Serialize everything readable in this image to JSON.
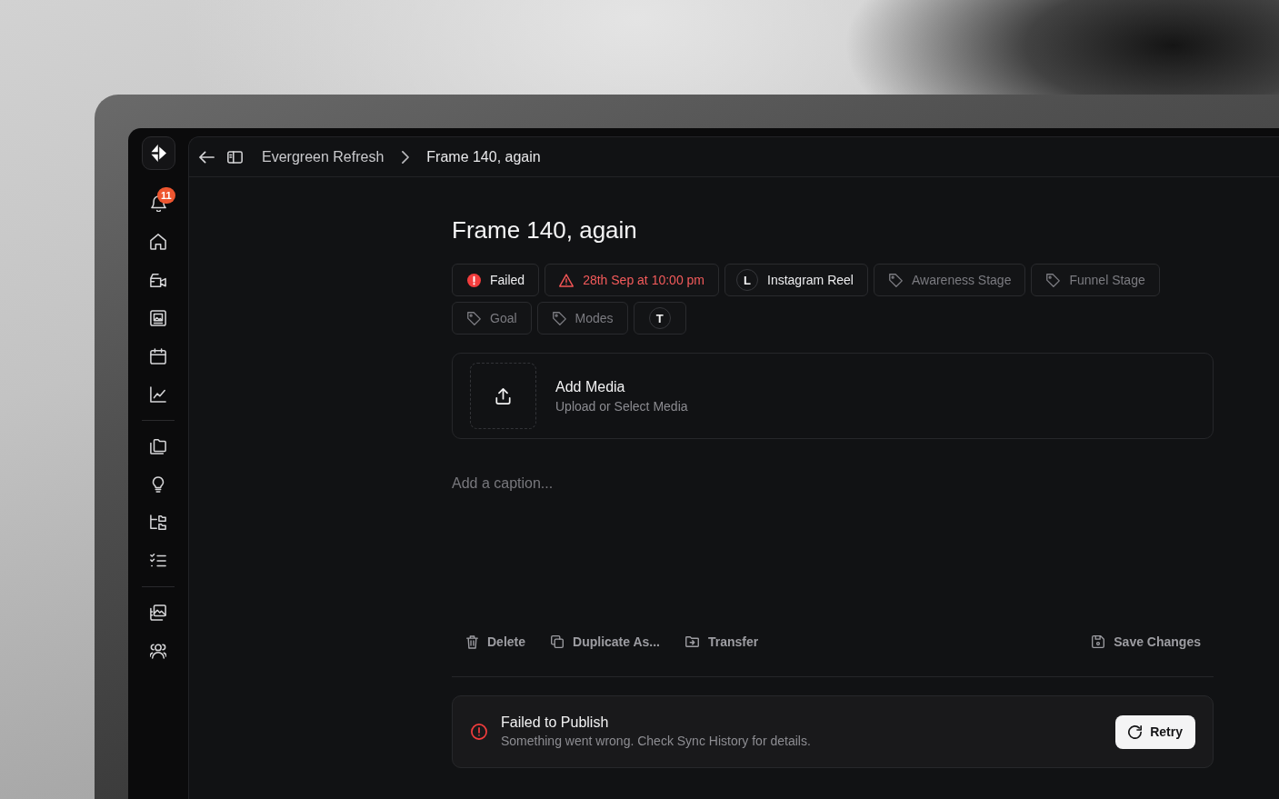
{
  "sidebar": {
    "notification_badge": "11"
  },
  "breadcrumb": [
    {
      "label": "Evergreen Refresh"
    },
    {
      "label": "Frame 140, again"
    }
  ],
  "title": "Frame 140, again",
  "chips": [
    {
      "kind": "status",
      "label": "Failed"
    },
    {
      "kind": "date",
      "label": "28th Sep at 10:00 pm"
    },
    {
      "kind": "account",
      "initial": "L",
      "label": "Instagram Reel"
    },
    {
      "kind": "tag",
      "label": "Awareness Stage"
    },
    {
      "kind": "tag",
      "label": "Funnel Stage"
    },
    {
      "kind": "tag",
      "label": "Goal"
    },
    {
      "kind": "tag",
      "label": "Modes"
    },
    {
      "kind": "assignee",
      "initial": "T"
    }
  ],
  "media": {
    "title": "Add Media",
    "subtitle": "Upload or Select Media"
  },
  "caption": {
    "placeholder": "Add a caption..."
  },
  "actions": [
    {
      "kind": "delete",
      "label": "Delete"
    },
    {
      "kind": "duplicate",
      "label": "Duplicate As..."
    },
    {
      "kind": "transfer",
      "label": "Transfer"
    },
    {
      "kind": "save",
      "label": "Save Changes"
    }
  ],
  "alert": {
    "title": "Failed to Publish",
    "message": "Something went wrong. Check Sync History for details.",
    "button": "Retry"
  }
}
